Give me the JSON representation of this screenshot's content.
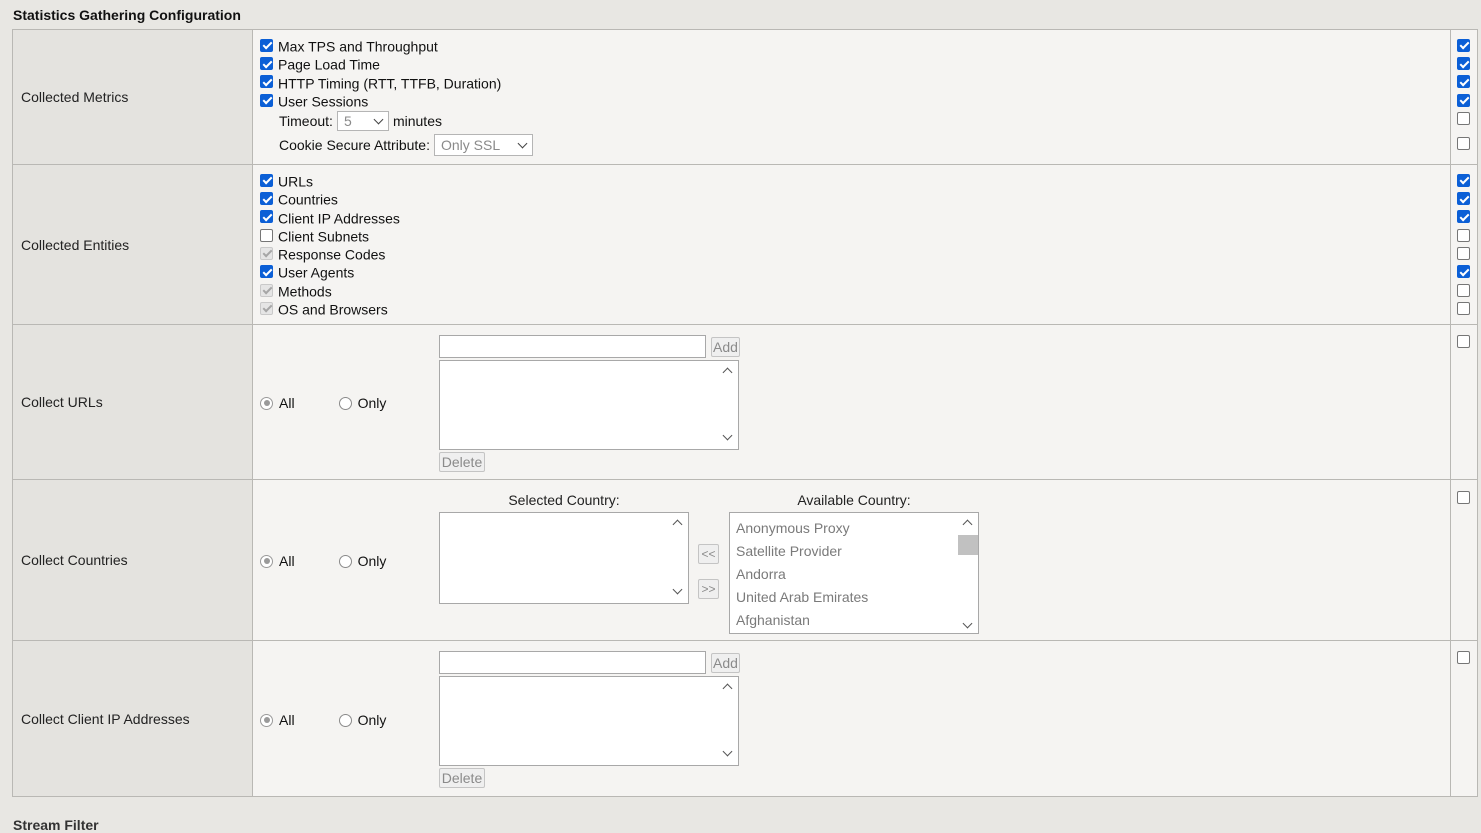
{
  "section_title": "Statistics Gathering Configuration",
  "metrics": {
    "label": "Collected Metrics",
    "options": [
      {
        "label": "Max TPS and Throughput",
        "state": "checked",
        "right": "checked"
      },
      {
        "label": "Page Load Time",
        "state": "checked",
        "right": "checked"
      },
      {
        "label": "HTTP Timing (RTT, TTFB, Duration)",
        "state": "checked",
        "right": "checked"
      },
      {
        "label": "User Sessions",
        "state": "checked",
        "right": "checked"
      }
    ],
    "timeout_label": "Timeout:",
    "timeout_value": "5",
    "timeout_unit": "minutes",
    "cookie_label": "Cookie Secure Attribute:",
    "cookie_value": "Only SSL"
  },
  "entities": {
    "label": "Collected Entities",
    "options": [
      {
        "label": "URLs",
        "state": "checked",
        "right": "checked"
      },
      {
        "label": "Countries",
        "state": "checked",
        "right": "checked"
      },
      {
        "label": "Client IP Addresses",
        "state": "checked",
        "right": "checked"
      },
      {
        "label": "Client Subnets",
        "state": "unchecked",
        "right": "unchecked"
      },
      {
        "label": "Response Codes",
        "state": "disabled",
        "right": "unchecked"
      },
      {
        "label": "User Agents",
        "state": "checked",
        "right": "checked"
      },
      {
        "label": "Methods",
        "state": "disabled",
        "right": "unchecked"
      },
      {
        "label": "OS and Browsers",
        "state": "disabled",
        "right": "unchecked"
      }
    ]
  },
  "collect_urls": {
    "label": "Collect URLs",
    "radio_all": "All",
    "radio_only": "Only",
    "add_label": "Add",
    "delete_label": "Delete"
  },
  "collect_countries": {
    "label": "Collect Countries",
    "radio_all": "All",
    "radio_only": "Only",
    "selected_heading": "Selected Country:",
    "available_heading": "Available Country:",
    "move_left": "<<",
    "move_right": ">>",
    "available": [
      "Anonymous Proxy",
      "Satellite Provider",
      "Andorra",
      "United Arab Emirates",
      "Afghanistan"
    ]
  },
  "collect_ips": {
    "label": "Collect Client IP Addresses",
    "radio_all": "All",
    "radio_only": "Only",
    "add_label": "Add",
    "delete_label": "Delete"
  },
  "next_section_partial": "Stream Filter"
}
